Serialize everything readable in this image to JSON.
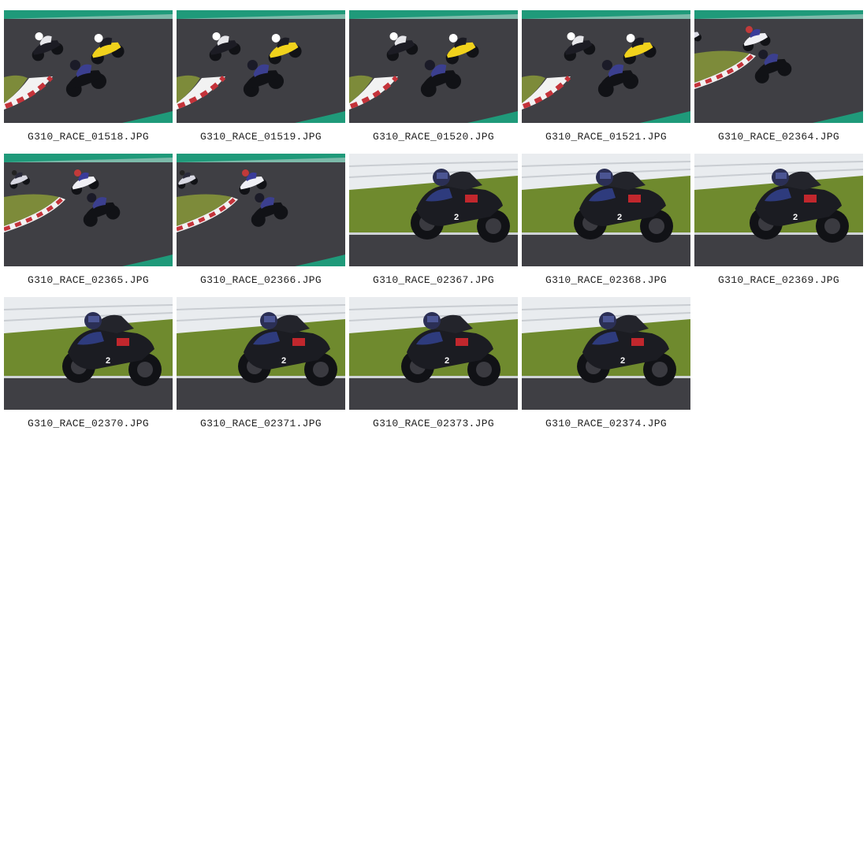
{
  "gallery": {
    "photos": [
      {
        "filename": "G310_RACE_01518.JPG",
        "scene": "corner-group"
      },
      {
        "filename": "G310_RACE_01519.JPG",
        "scene": "corner-group"
      },
      {
        "filename": "G310_RACE_01520.JPG",
        "scene": "corner-group"
      },
      {
        "filename": "G310_RACE_01521.JPG",
        "scene": "corner-group"
      },
      {
        "filename": "G310_RACE_02364.JPG",
        "scene": "corner-far"
      },
      {
        "filename": "G310_RACE_02365.JPG",
        "scene": "corner-far"
      },
      {
        "filename": "G310_RACE_02366.JPG",
        "scene": "corner-far"
      },
      {
        "filename": "G310_RACE_02367.JPG",
        "scene": "closeup"
      },
      {
        "filename": "G310_RACE_02368.JPG",
        "scene": "closeup"
      },
      {
        "filename": "G310_RACE_02369.JPG",
        "scene": "closeup"
      },
      {
        "filename": "G310_RACE_02370.JPG",
        "scene": "closeup"
      },
      {
        "filename": "G310_RACE_02371.JPG",
        "scene": "closeup"
      },
      {
        "filename": "G310_RACE_02373.JPG",
        "scene": "closeup"
      },
      {
        "filename": "G310_RACE_02374.JPG",
        "scene": "closeup"
      }
    ]
  },
  "bike_number": "2",
  "colors": {
    "asphalt": "#3f3f44",
    "grass_green": "#1f9a7a",
    "infield_grass": "#7d8b3a",
    "curb_red": "#c4333a",
    "curb_white": "#f2f2f2",
    "barrier_white": "#e9ecef",
    "field_grass": "#6f8a2e",
    "bike_black": "#111216"
  }
}
